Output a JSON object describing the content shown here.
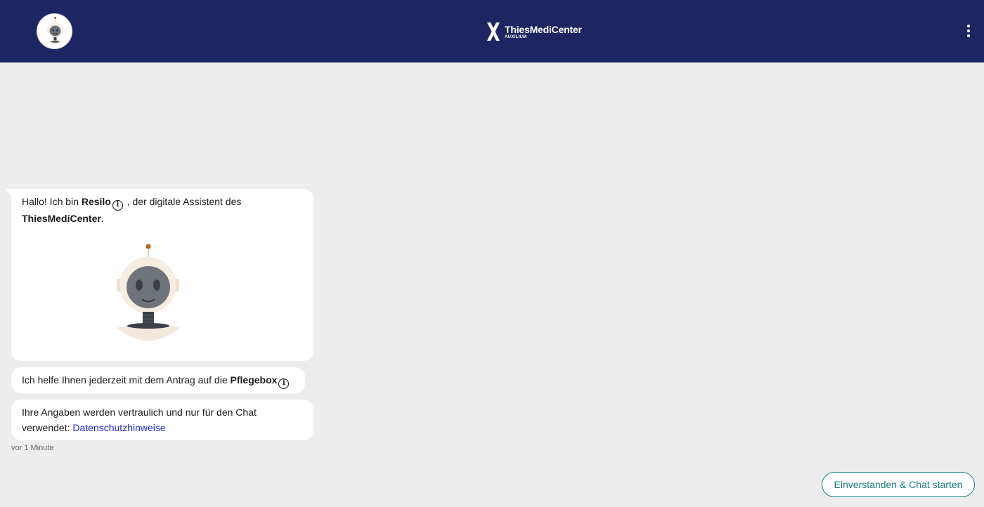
{
  "header": {
    "brand_name": "ThiesMediCenter",
    "brand_sub": "AUXILIUM",
    "avatar_icon": "robot-avatar-icon",
    "menu_icon": "kebab-menu-icon",
    "background_color": "#1e2563"
  },
  "chat": {
    "message1": {
      "prefix": "Hallo! Ich bin ",
      "name": "Resilo",
      "middle": " , der digitale Assistent des",
      "company": "ThiesMediCenter",
      "suffix": "."
    },
    "message2": {
      "prefix": "Ich helfe Ihnen jederzeit mit dem Antrag auf die ",
      "product": "Pflegebox"
    },
    "message3": {
      "text": "Ihre Angaben werden vertraulich und nur für den Chat verwendet: ",
      "link": "Datenschutzhinweise"
    },
    "timestamp": "vor 1 Minute",
    "info_icon_glyph": "i"
  },
  "actions": {
    "start_button": "Einverstanden & Chat starten",
    "accent_color": "#1b7b80"
  }
}
